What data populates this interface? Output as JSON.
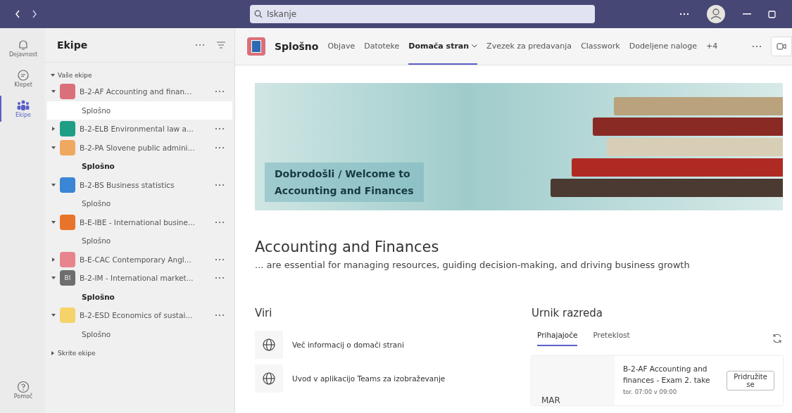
{
  "search": {
    "placeholder": "Iskanje"
  },
  "rail": [
    {
      "label": "Dejavnost",
      "kind": "bell",
      "selected": false
    },
    {
      "label": "Klepet",
      "kind": "chat",
      "selected": false
    },
    {
      "label": "Ekipe",
      "kind": "teams",
      "selected": true
    }
  ],
  "help": {
    "label": "Pomoč"
  },
  "sidebar": {
    "title": "Ekipe",
    "section": "Vaše ekipe",
    "hidden": "Skrite ekipe",
    "teams": [
      {
        "name": "B-2-AF Accounting and finan...",
        "color": "#d9707a",
        "expanded": true,
        "channels": [
          {
            "name": "Splošno",
            "bold": false,
            "selected": true
          }
        ]
      },
      {
        "name": "B-2-ELB Environmental law a...",
        "color": "#1f9e86",
        "expanded": false
      },
      {
        "name": "B-2-PA Slovene public admini...",
        "color": "#f0a860",
        "expanded": true,
        "channels": [
          {
            "name": "Splošno",
            "bold": true,
            "selected": false
          }
        ]
      },
      {
        "name": "B-2-BS Business statistics",
        "color": "#3a86d4",
        "expanded": true,
        "channels": [
          {
            "name": "Splošno",
            "bold": false,
            "selected": false
          }
        ]
      },
      {
        "name": "B-E-IBE - International busine...",
        "color": "#e8742c",
        "expanded": true,
        "channels": [
          {
            "name": "Splošno",
            "bold": false,
            "selected": false
          }
        ]
      },
      {
        "name": "B-E-CAC Contemporary Angl...",
        "color": "#e8848e",
        "expanded": false
      },
      {
        "name": "B-2-IM - International market...",
        "color": "#6e6e6e",
        "icon_label": "BI",
        "expanded": true,
        "channels": [
          {
            "name": "Splošno",
            "bold": true,
            "selected": false
          }
        ]
      },
      {
        "name": "B-2-ESD Economics of sustai...",
        "color": "#f5d36a",
        "expanded": true,
        "channels": [
          {
            "name": "Splošno",
            "bold": false,
            "selected": false
          }
        ]
      }
    ]
  },
  "channel": {
    "title": "Splošno",
    "tabs": [
      {
        "label": "Objave",
        "selected": false
      },
      {
        "label": "Datoteke",
        "selected": false
      },
      {
        "label": "Domača stran",
        "selected": true
      },
      {
        "label": "Zvezek za predavanja",
        "selected": false
      },
      {
        "label": "Classwork",
        "selected": false
      },
      {
        "label": "Dodeljene naloge",
        "selected": false
      }
    ],
    "more_tabs": "+4"
  },
  "banner": {
    "lines": [
      "Dobrodošli / Welcome to",
      "Accounting and Finances"
    ]
  },
  "heading": "Accounting and Finances",
  "subtitle": "... are essential for managing resources, guiding decision-making, and driving business growth",
  "resources": {
    "title": "Viri",
    "items": [
      "Več informacij o domači strani",
      "Uvod v aplikacijo Teams za izobraževanje"
    ]
  },
  "schedule": {
    "title": "Urnik razreda",
    "tabs": [
      {
        "label": "Prihajajoče",
        "selected": true
      },
      {
        "label": "Preteklost",
        "selected": false
      }
    ],
    "event": {
      "month": "MAR",
      "title": "B-2-AF Accounting and finances - Exam 2. take",
      "time": "tor. 07:00 v 09:00",
      "join": "Pridružite se"
    }
  }
}
